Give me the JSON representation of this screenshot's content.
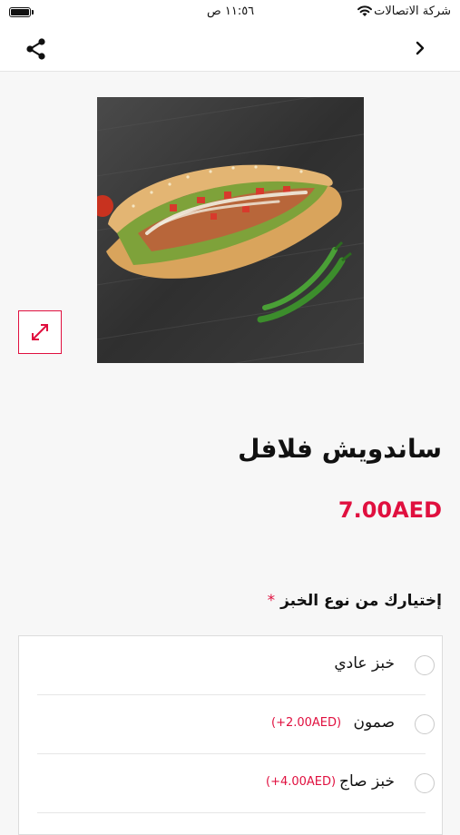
{
  "status_bar": {
    "carrier": "شركة الاتصالات",
    "time": "١١:٥٦ ص"
  },
  "nav": {
    "share_icon": "share-icon",
    "back_icon": "chevron-right-icon"
  },
  "product": {
    "image_icon": "falafel-sandwich-photo",
    "expand_icon": "expand-arrows-icon",
    "title": "ساندويش فلافل",
    "price": "7.00AED"
  },
  "bread_section": {
    "label": "إختيارك من نوع الخبز",
    "required_mark": "*",
    "options": [
      {
        "label": "خبز عادي",
        "extra": ""
      },
      {
        "label": "صمون",
        "extra": "(+2.00AED)"
      },
      {
        "label": "خبز صاج",
        "extra": "(+4.00AED)"
      }
    ]
  },
  "colors": {
    "accent": "#e0103f",
    "background": "#f7f7f7"
  }
}
